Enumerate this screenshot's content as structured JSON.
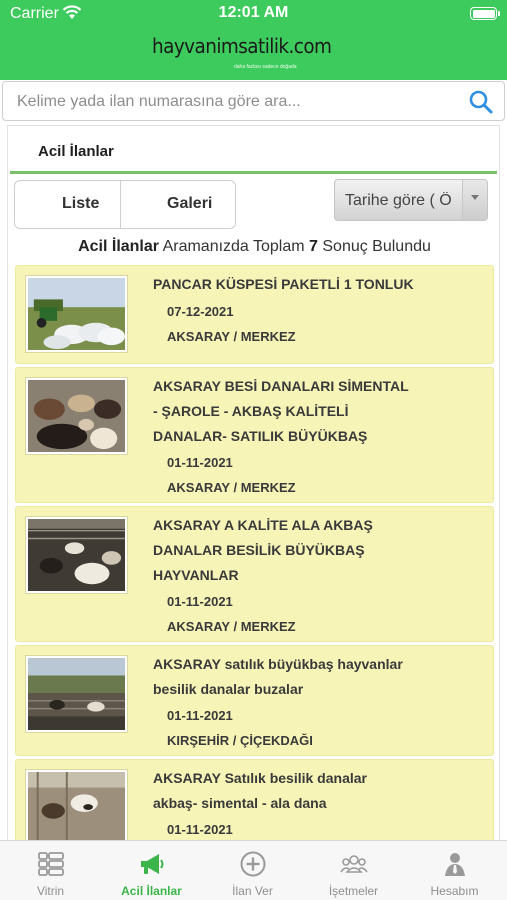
{
  "status_bar": {
    "carrier": "Carrier",
    "time": "12:01 AM"
  },
  "header": {
    "logo_text": "hayvanimsatilik.com",
    "logo_tagline": "daha fazlası sadece doğada"
  },
  "search": {
    "placeholder": "Kelime yada ilan numarasına göre ara..."
  },
  "section": {
    "title": "Acil İlanlar"
  },
  "view_toggle": {
    "list_label": "Liste",
    "gallery_label": "Galeri"
  },
  "sort": {
    "selected": "Tarihe göre ( Ö"
  },
  "summary": {
    "prefix": "Acil İlanlar",
    "middle": " Aramanızda Toplam ",
    "count": "7",
    "suffix": " Sonuç Bulundu"
  },
  "listings": [
    {
      "title_lines": [
        "PANCAR KÜSPESİ PAKETLİ 1 TONLUK"
      ],
      "date": "07-12-2021",
      "location": "AKSARAY / MERKEZ",
      "image_icon": "hay-bales-tractor-photo"
    },
    {
      "title_lines": [
        "AKSARAY BESİ DANALARI SİMENTAL",
        "- ŞAROLE - AKBAŞ KALİTELİ",
        "DANALAR- SATILIK BÜYÜKBAŞ"
      ],
      "date": "01-11-2021",
      "location": "AKSARAY / MERKEZ",
      "image_icon": "cattle-herd-photo"
    },
    {
      "title_lines": [
        "AKSARAY A KALİTE ALA AKBAŞ",
        "DANALAR BESİLİK BÜYÜKBAŞ",
        "HAYVANLAR"
      ],
      "date": "01-11-2021",
      "location": "AKSARAY / MERKEZ",
      "image_icon": "cattle-pen-photo"
    },
    {
      "title_lines": [
        "AKSARAY satılık büyükbaş hayvanlar",
        "besilik danalar buzalar"
      ],
      "date": "01-11-2021",
      "location": "KIRŞEHİR / ÇİÇEKDAĞI",
      "image_icon": "barn-yard-photo"
    },
    {
      "title_lines": [
        "AKSARAY Satılık besilik danalar",
        "akbaş- simental - ala dana"
      ],
      "date": "01-11-2021",
      "location": "",
      "image_icon": "calves-photo"
    }
  ],
  "tabbar": {
    "items": [
      {
        "label": "Vitrin",
        "icon": "grid-icon"
      },
      {
        "label": "Acil İlanlar",
        "icon": "megaphone-icon",
        "active": true
      },
      {
        "label": "İlan Ver",
        "icon": "plus-circle-icon"
      },
      {
        "label": "İşetmeler",
        "icon": "people-icon"
      },
      {
        "label": "Hesabım",
        "icon": "user-icon"
      }
    ]
  },
  "colors": {
    "header_green": "#3ecb5d",
    "card_yellow": "#f6f4b7",
    "active_tab": "#3bb54a",
    "divider_green": "#7ac06b"
  }
}
